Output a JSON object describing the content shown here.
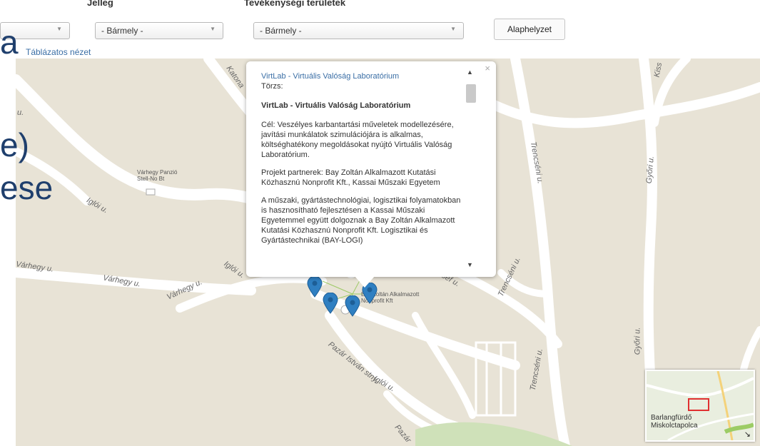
{
  "filters": {
    "label_jelleg": "Jelleg",
    "label_tevekenyseg": "Tevékenységi területek",
    "select_first_arrow": "▼",
    "select_jelleg_value": "- Bármely -",
    "select_tevekenyseg_value": "- Bármely -",
    "reset_button": "Alaphelyzet",
    "table_view_link": "Táblázatos nézet"
  },
  "slide_overlay": {
    "line1": "a",
    "line2": "e)",
    "line3": "ese"
  },
  "map": {
    "roads": {
      "katona": "Katona",
      "iglo_1": "Iglói u.",
      "iglo_2": "Iglói u.",
      "iglo_3": "Iglói u.",
      "varhegy_1": "Várhegy u.",
      "varhegy_2": "Várhegy u.",
      "varhegy_3": "Várhegy u.",
      "varhegy_4": "Várhegy u.",
      "trencseni_1": "Trencséni u.",
      "trencseni_2": "Trencséni u.",
      "trencseni_3": "Trencséni u.",
      "gyori_1": "Győri u.",
      "gyori_2": "Győri u.",
      "jozsef": "József u.",
      "pazar_1": "Pazár István stny.",
      "pazar_2": "Pazár",
      "kiss": "Kiss",
      "u_left": "u."
    },
    "poi_varhegy": "Várhegy Panzió\nStell-No Bt",
    "poi_bayzoltan": "Bay Zoltán Alkalmazott\nNonprofit Kft"
  },
  "popup": {
    "title_link": "VirtLab - Virtuális Valóság Laboratórium",
    "torzs": "Törzs:",
    "heading": "VirtLab - Virtuális Valóság Laboratórium",
    "goal": "Cél: Veszélyes karbantartási műveletek modellezésére, javítási munkálatok szimulációjára is alkalmas, költséghatékony megoldásokat nyújtó Virtuális Valóság Laboratórium.",
    "partners": "Projekt partnerek: Bay Zoltán Alkalmazott Kutatási Közhasznú Nonprofit Kft., Kassai Műszaki Egyetem",
    "description": "A műszaki, gyártástechnológiai, logisztikai folyamatokban is hasznosítható fejlesztésen a Kassai Műszaki Egyetemmel együtt dolgoznak a Bay Zoltán Alkalmazott Kutatási Közhasznú Nonprofit Kft. Logisztikai és Gyártástechnikai (BAY-LOGI)",
    "close": "×",
    "scroll_up": "▲",
    "scroll_down": "▼"
  },
  "overview": {
    "place": "Barlangfürdő\nMiskolctapolca",
    "toggle": "↘"
  },
  "colors": {
    "map_bg": "#e8e3d6",
    "road": "#ffffff",
    "marker": "#2f7fc1",
    "link": "#3a6ea5"
  }
}
